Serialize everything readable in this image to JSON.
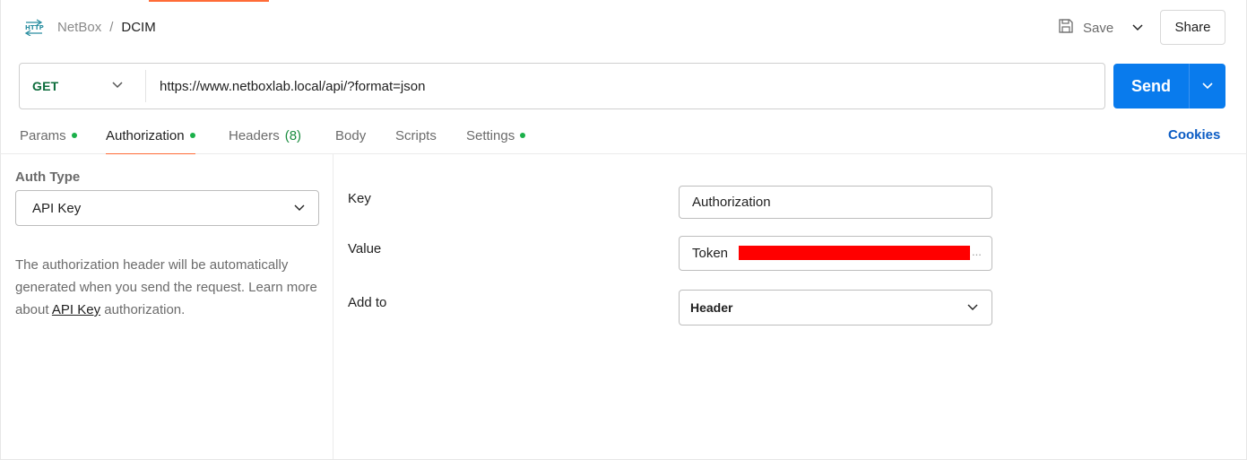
{
  "breadcrumb": {
    "parent": "NetBox",
    "separator": "/",
    "current": "DCIM"
  },
  "toolbar": {
    "save_label": "Save",
    "share_label": "Share"
  },
  "request": {
    "method": "GET",
    "url": "https://www.netboxlab.local/api/?format=json",
    "send_label": "Send"
  },
  "tabs": [
    {
      "label": "Params",
      "dot": true
    },
    {
      "label": "Authorization",
      "dot": true,
      "active": true
    },
    {
      "label": "Headers",
      "count": "(8)"
    },
    {
      "label": "Body"
    },
    {
      "label": "Scripts"
    },
    {
      "label": "Settings",
      "dot": true
    }
  ],
  "cookies_label": "Cookies",
  "auth": {
    "type_label": "Auth Type",
    "type_value": "API Key",
    "description_before": "The authorization header will be automatically generated when you send the request. Learn more about ",
    "description_link": "API Key",
    "description_after": " authorization."
  },
  "fields": {
    "key_label": "Key",
    "key_value": "Authorization",
    "value_label": "Value",
    "value_prefix": "Token",
    "value_ellipsis": "...",
    "addto_label": "Add to",
    "addto_value": "Header"
  },
  "colors": {
    "accent_orange": "#ff6c37",
    "send_blue": "#097bed",
    "method_green": "#0b6b3a",
    "dot_green": "#1bb04a",
    "link_blue": "#0b5cc4",
    "redaction": "#ff0000"
  },
  "icons": {
    "http": "http-request-icon",
    "save": "save-icon",
    "chevron": "chevron-down-icon"
  }
}
